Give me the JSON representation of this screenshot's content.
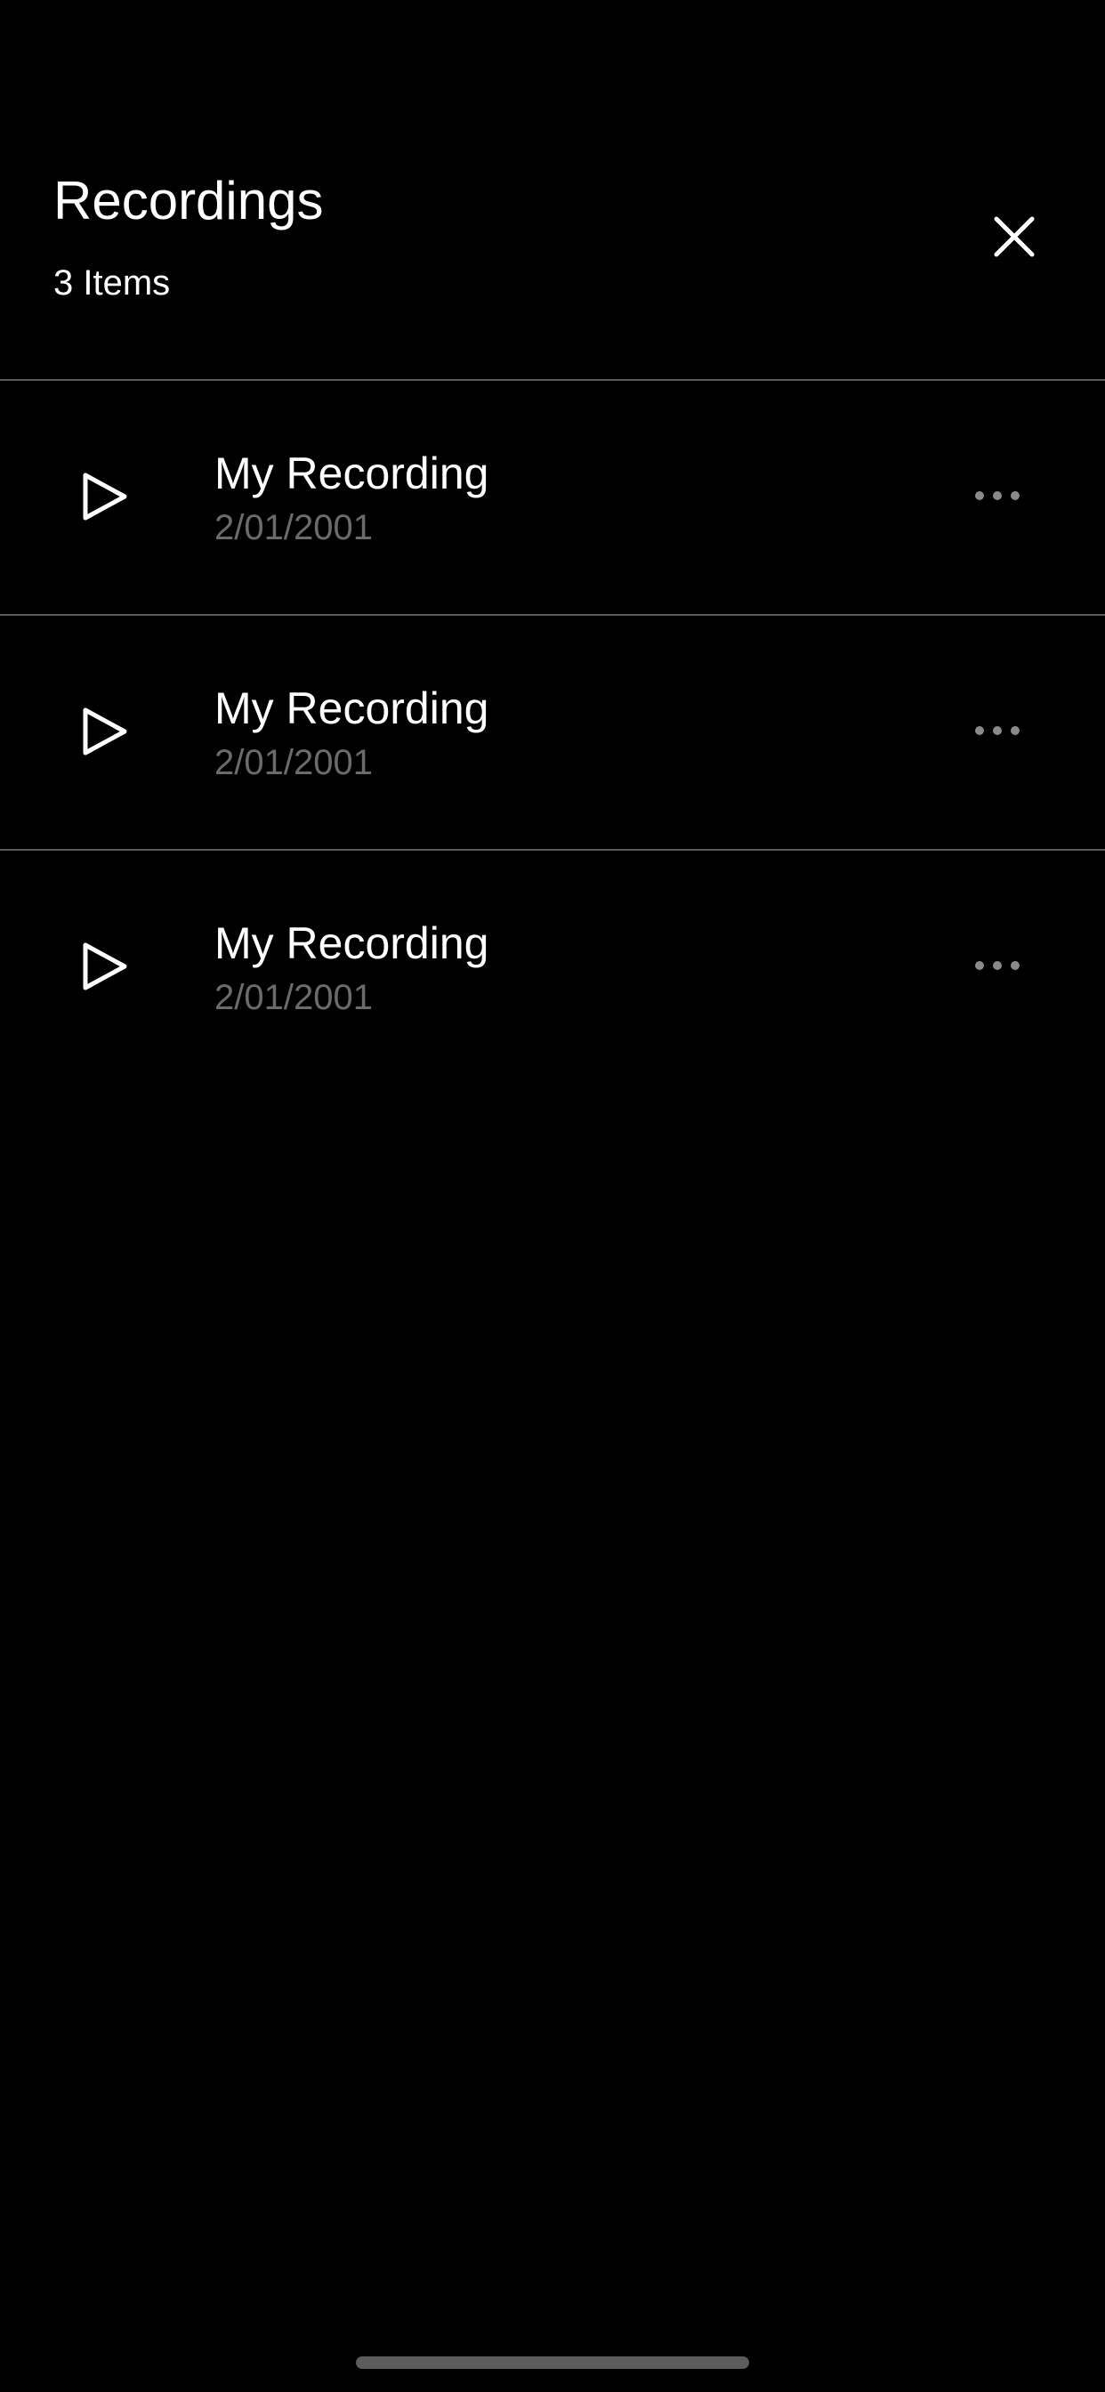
{
  "header": {
    "title": "Recordings",
    "count_label": "3 Items",
    "close_icon": "close-icon"
  },
  "recordings": [
    {
      "title": "My Recording",
      "date": "2/01/2001",
      "play_icon": "play-icon",
      "more_icon": "more-horizontal-icon"
    },
    {
      "title": "My Recording",
      "date": "2/01/2001",
      "play_icon": "play-icon",
      "more_icon": "more-horizontal-icon"
    },
    {
      "title": "My Recording",
      "date": "2/01/2001",
      "play_icon": "play-icon",
      "more_icon": "more-horizontal-icon"
    }
  ],
  "colors": {
    "background": "#000000",
    "primary_text": "#ffffff",
    "secondary_text": "#6b6b6b",
    "divider": "#5a5a5a",
    "more_dots": "#8a8a8a"
  }
}
